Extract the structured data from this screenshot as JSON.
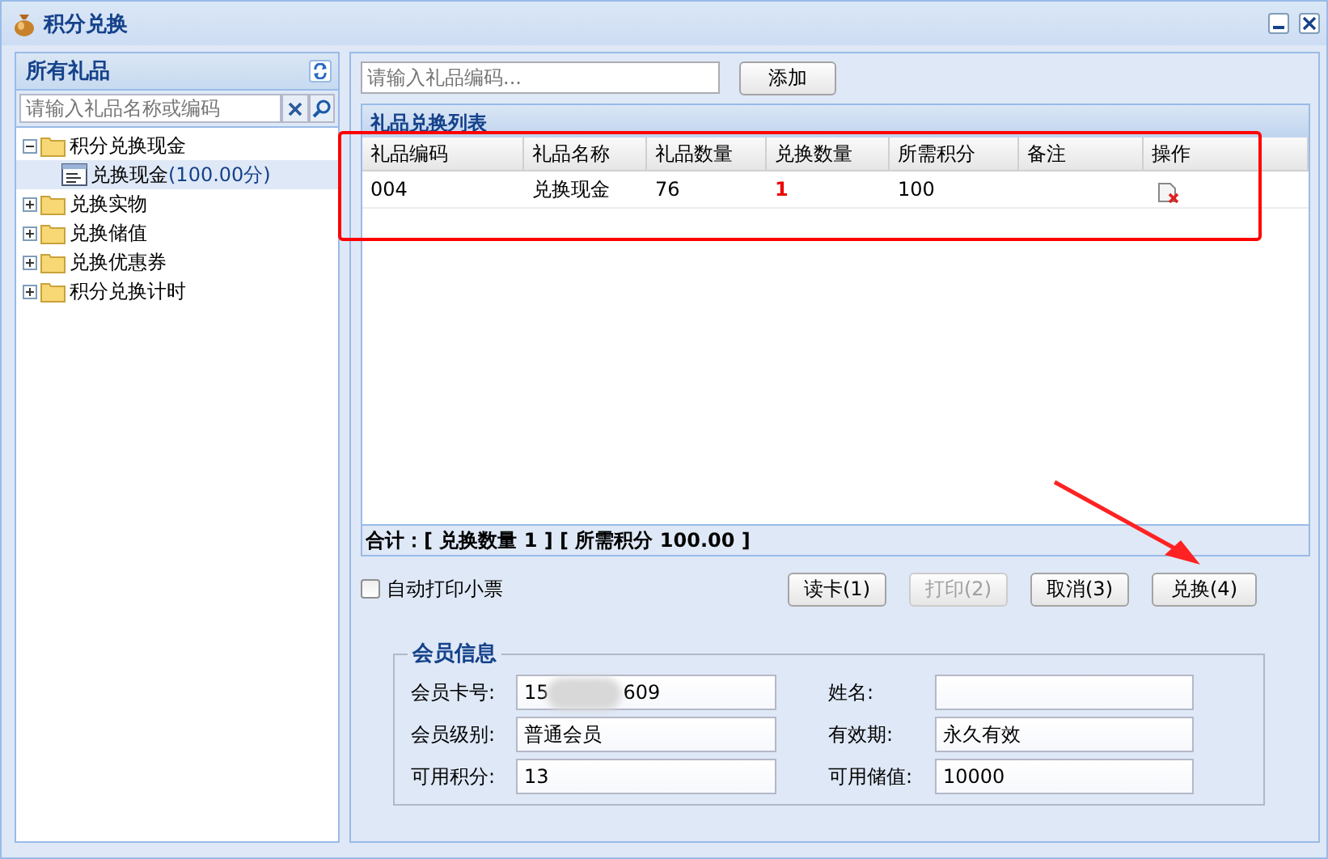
{
  "window": {
    "title": "积分兑换"
  },
  "sidebar": {
    "title": "所有礼品",
    "search": {
      "placeholder": "请输入礼品名称或编码"
    },
    "tree": [
      {
        "label": "积分兑换现金",
        "expanded": true,
        "selected": false,
        "children": [
          {
            "label": "兑换现金",
            "detail": "(100.00分)",
            "selected": true
          }
        ]
      },
      {
        "label": "兑换实物",
        "expanded": false,
        "selected": false
      },
      {
        "label": "兑换储值",
        "expanded": false,
        "selected": false
      },
      {
        "label": "兑换优惠券",
        "expanded": false,
        "selected": false
      },
      {
        "label": "积分兑换计时",
        "expanded": false,
        "selected": false
      }
    ]
  },
  "code_input": {
    "placeholder": "请输入礼品编码..."
  },
  "add_button": "添加",
  "table": {
    "title": "礼品兑换列表",
    "columns": [
      "礼品编码",
      "礼品名称",
      "礼品数量",
      "兑换数量",
      "所需积分",
      "备注",
      "操作"
    ],
    "rows": [
      {
        "cells": [
          "004",
          "兑换现金",
          "76",
          "1",
          "100",
          ""
        ]
      }
    ]
  },
  "summary": "**合计：**[ **兑换数量 1** ] [ **所需积分 100.00** ]",
  "auto_print": {
    "label": "自动打印小票",
    "checked": false
  },
  "buttons": [
    {
      "label": "读卡(1)",
      "disabled": false
    },
    {
      "label": "打印(2)",
      "disabled": true
    },
    {
      "label": "取消(3)",
      "disabled": false
    },
    {
      "label": "兑换(4)",
      "disabled": false
    }
  ],
  "member": {
    "title": "会员信息",
    "fields": [
      {
        "label": "会员卡号:",
        "value_start": "15",
        "value_end": "609",
        "blurred": true
      },
      {
        "label": "姓名:"
      },
      {
        "label": "会员级别:",
        "value_start": "普通会员"
      },
      {
        "label": "有效期:",
        "value_start": "永久有效"
      },
      {
        "label": "可用积分:",
        "value_start": "13"
      },
      {
        "label": "可用储值:",
        "value_start": "10000"
      }
    ]
  }
}
